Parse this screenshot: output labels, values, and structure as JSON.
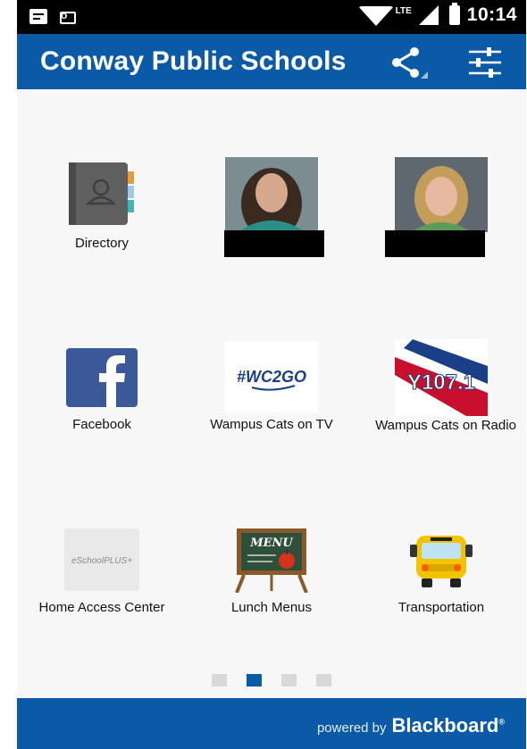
{
  "status_bar": {
    "time": "10:14",
    "network": "LTE",
    "icons": [
      "message-icon",
      "outlook-icon",
      "wifi-icon",
      "signal-icon",
      "battery-icon"
    ]
  },
  "app_bar": {
    "title": "Conway Public Schools",
    "actions": [
      "share-icon",
      "filter-icon"
    ]
  },
  "tiles": [
    {
      "name": "directory",
      "label": "Directory",
      "icon": "address-book-icon"
    },
    {
      "name": "student-photo-1",
      "label": "",
      "icon": "student-photo",
      "redacted": true
    },
    {
      "name": "student-photo-2",
      "label": "",
      "icon": "student-photo",
      "redacted": true
    },
    {
      "name": "facebook",
      "label": "Facebook",
      "icon": "facebook-icon"
    },
    {
      "name": "wampus-tv",
      "label": "Wampus Cats on TV",
      "icon": "wc2go-logo",
      "logo_text": "#WC2GO"
    },
    {
      "name": "wampus-radio",
      "label": "Wampus Cats on Radio",
      "icon": "y107-logo",
      "logo_text": "Y107.1"
    },
    {
      "name": "home-access",
      "label": "Home Access Center",
      "icon": "eschoolplus-logo",
      "logo_text": "eSchoolPLUS+"
    },
    {
      "name": "lunch-menus",
      "label": "Lunch Menus",
      "icon": "menu-chalkboard-icon",
      "logo_text": "MENU"
    },
    {
      "name": "transportation",
      "label": "Transportation",
      "icon": "school-bus-icon"
    }
  ],
  "pager": {
    "pages": 4,
    "active": 2
  },
  "footer": {
    "powered_by": "powered by",
    "brand": "Blackboard"
  },
  "colors": {
    "primary": "#0a5aa8",
    "background": "#f7f7f7",
    "status_bar": "#000000",
    "facebook": "#3b5998"
  }
}
